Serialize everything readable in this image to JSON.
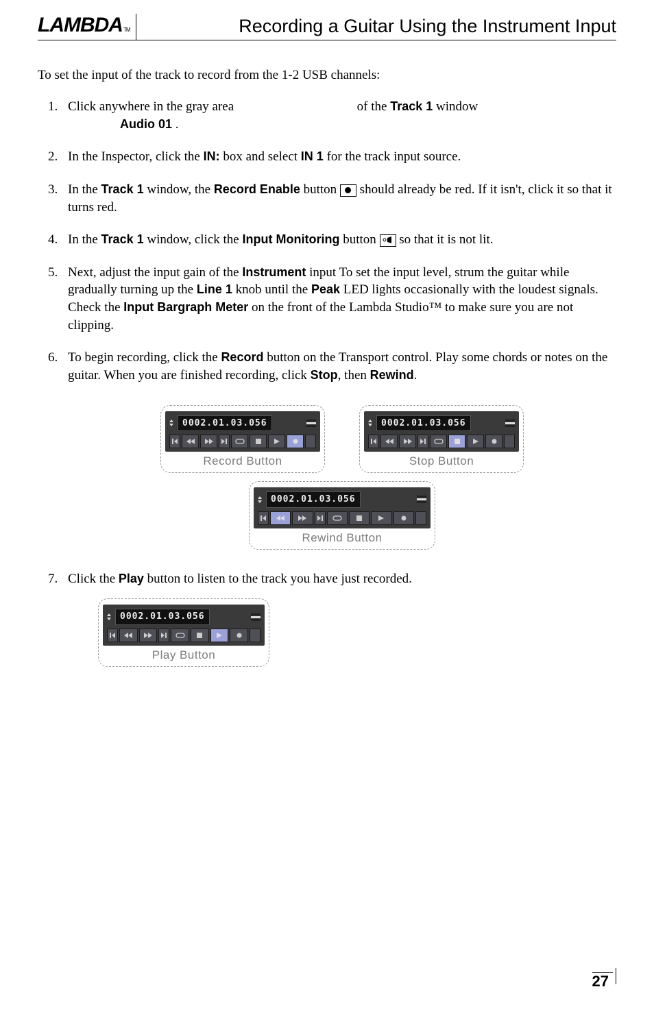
{
  "header": {
    "logo_text": "LAMBDA",
    "logo_tm": "TM",
    "section_title": "Recording a Guitar Using the Instrument Input"
  },
  "intro": "To set the input of the track to record from the 1-2 USB channels:",
  "steps": {
    "s1_a": "Click anywhere in the gray area",
    "s1_b": "of the ",
    "s1_track": "Track 1",
    "s1_c": " window",
    "s1_audio": "Audio 01",
    "s1_d": " .",
    "s2_a": "In the Inspector, click the ",
    "s2_in": "IN:",
    "s2_b": " box and select ",
    "s2_in1": "IN 1",
    "s2_c": " for the track input source.",
    "s3_a": "In the ",
    "s3_track": "Track 1",
    "s3_b": " window, the ",
    "s3_recenable": "Record Enable",
    "s3_c": " button ",
    "s3_d": " should already be red. If it isn't, click it so that it turns red.",
    "s4_a": "In the ",
    "s4_track": "Track 1",
    "s4_b": " window, click the ",
    "s4_inmon": "Input Monitoring",
    "s4_c": " button ",
    "s4_d": " so that it is not lit.",
    "s5_a": "Next, adjust the input gain of the ",
    "s5_inst": "Instrument",
    "s5_b": " input  To set the input level, strum the guitar while gradually turning up the ",
    "s5_line1": "Line 1",
    "s5_c": " knob until the ",
    "s5_peak": "Peak",
    "s5_d": " LED lights occasionally with the loudest signals. Check the ",
    "s5_barg": "Input Bargraph Meter",
    "s5_e": " on the front of the Lambda Studio™ to make sure you are not clipping.",
    "s6_a": "To begin recording, click the ",
    "s6_rec": "Record",
    "s6_b": " button on the Transport control. Play some chords or notes on the guitar. When you are finished recording, click ",
    "s6_stop": "Stop",
    "s6_c": ", then ",
    "s6_rew": "Rewind",
    "s6_d": ".",
    "s7_a": "Click the ",
    "s7_play": "Play",
    "s7_b": " button to listen to the track you have just recorded."
  },
  "figures": {
    "timecode": "0002.01.03.056",
    "record_caption": "Record Button",
    "stop_caption": "Stop Button",
    "rewind_caption": "Rewind Button",
    "play_caption": "Play Button"
  },
  "footer": {
    "page": "27"
  }
}
